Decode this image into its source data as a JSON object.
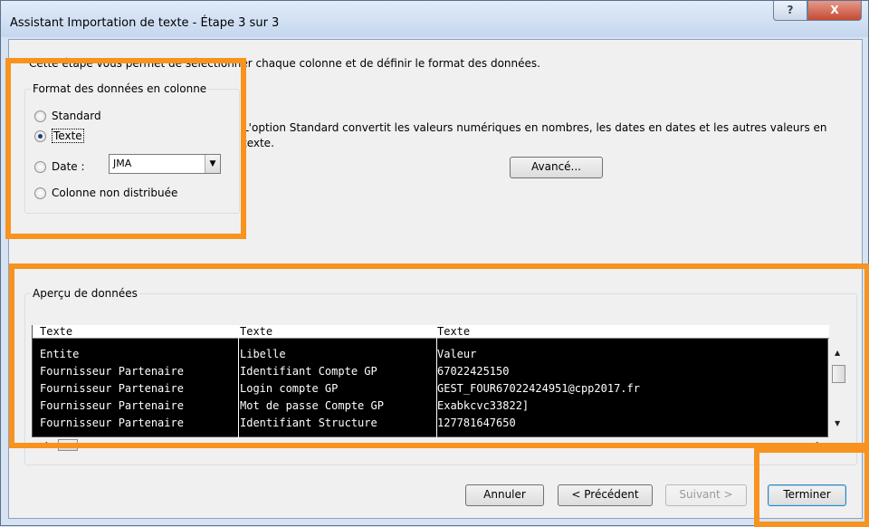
{
  "window": {
    "title": "Assistant Importation de texte - Étape 3 sur 3",
    "help_label": "?",
    "close_label": "X"
  },
  "intro_text": "Cette étape vous permet de sélectionner chaque colonne et de définir le format des données.",
  "format_group": {
    "legend": "Format des données en colonne",
    "options": [
      {
        "label": "Standard",
        "checked": false
      },
      {
        "label": "Texte",
        "checked": true
      },
      {
        "label": "Date :",
        "checked": false
      },
      {
        "label": "Colonne non distribuée",
        "checked": false
      }
    ],
    "date_format_value": "JMA"
  },
  "description": "L'option Standard convertit les valeurs numériques en nombres, les dates en dates et les autres valeurs en texte.",
  "advanced_button": "Avancé...",
  "preview": {
    "legend": "Aperçu de données",
    "column_headers": [
      "Texte",
      "Texte",
      "Texte"
    ],
    "rows": [
      [
        "Entite",
        "Libelle",
        "Valeur"
      ],
      [
        "Fournisseur Partenaire",
        "Identifiant Compte GP",
        "67022425150"
      ],
      [
        "Fournisseur Partenaire",
        "Login compte GP",
        "GEST_FOUR67022424951@cpp2017.fr"
      ],
      [
        "Fournisseur Partenaire",
        "Mot de passe Compte GP",
        "Exabkcvc33822]"
      ],
      [
        "Fournisseur Partenaire",
        "Identifiant Structure",
        "127781647650"
      ]
    ]
  },
  "buttons": {
    "cancel": "Annuler",
    "previous": "< Précédent",
    "next": "Suivant >",
    "finish": "Terminer"
  },
  "colors": {
    "highlight": "#f7931e"
  }
}
